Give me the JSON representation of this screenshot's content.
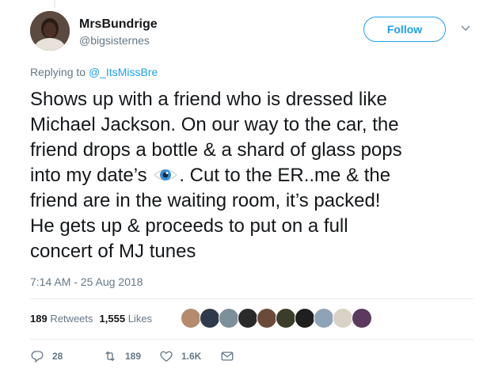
{
  "user": {
    "display_name": "MrsBundrige",
    "handle": "@bigsisternes"
  },
  "follow_label": "Follow",
  "reply_to": {
    "prefix": "Replying to ",
    "handle": "@_ItsMissBre"
  },
  "tweet": {
    "text_before_emoji": "Shows up with a friend who is dressed like\nMichael Jackson. On our way to the car, the\nfriend drops a bottle & a shard of glass pops\ninto my date’s ",
    "emoji": "eye-emoji",
    "text_after_emoji": ". Cut to the ER..me & the\nfriend are in the waiting room, it’s packed!\nHe gets up & proceeds to put on a full\nconcert of MJ tunes"
  },
  "timestamp": "7:14 AM - 25 Aug 2018",
  "stats": {
    "retweets_count": "189",
    "retweets_label": "Retweets",
    "likes_count": "1,555",
    "likes_label": "Likes"
  },
  "liker_avatars": [
    "#b58b6d",
    "#2f3a4a",
    "#7d8f9b",
    "#2a2a2a",
    "#6b4a3a",
    "#3c3c2a",
    "#1f1f1f",
    "#8fa3b8",
    "#d9d2c6",
    "#5b3a5e"
  ],
  "actions": {
    "reply_count": "28",
    "retweet_count": "189",
    "like_count": "1.6K"
  },
  "colors": {
    "accent": "#1da1f2",
    "muted": "#657786",
    "text": "#14171a",
    "divider": "#e6ecf0"
  }
}
